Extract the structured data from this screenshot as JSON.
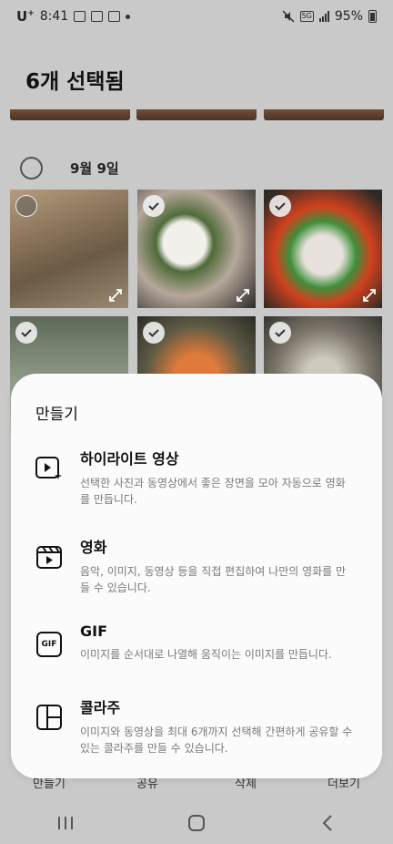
{
  "status_bar": {
    "carrier": "U",
    "carrier_sup": "+",
    "time": "8:41",
    "network": "5G",
    "battery": "95%"
  },
  "header": {
    "title": "6개 선택됨"
  },
  "gallery": {
    "date_label": "9월 9일",
    "thumbnails": [
      {
        "selected": false
      },
      {
        "selected": true
      },
      {
        "selected": true
      },
      {
        "selected": true
      },
      {
        "selected": true
      },
      {
        "selected": true
      }
    ]
  },
  "sheet": {
    "title": "만들기",
    "options": [
      {
        "icon": "highlight-video-icon",
        "title": "하이라이트 영상",
        "description": "선택한 사진과 동영상에서 좋은 장면을 모아 자동으로 영화를 만듭니다."
      },
      {
        "icon": "movie-clapper-icon",
        "title": "영화",
        "description": "음악, 이미지, 동영상 등을 직접 편집하여 나만의 영화를 만들 수 있습니다."
      },
      {
        "icon": "gif-icon",
        "title": "GIF",
        "icon_text": "GIF",
        "description": "이미지를 순서대로 나열해 움직이는 이미지를 만듭니다."
      },
      {
        "icon": "collage-icon",
        "title": "콜라주",
        "description": "이미지와 동영상을 최대 6개까지 선택해 간편하게 공유할 수 있는 콜라주를 만들 수 있습니다."
      }
    ]
  },
  "bottom_toolbar": {
    "items": [
      "만들기",
      "공유",
      "삭제",
      "더보기"
    ]
  },
  "colors": {
    "background_dim": "#c9c9c9",
    "sheet_bg": "#fbfbfb",
    "desc_text": "#7a7a7a"
  }
}
